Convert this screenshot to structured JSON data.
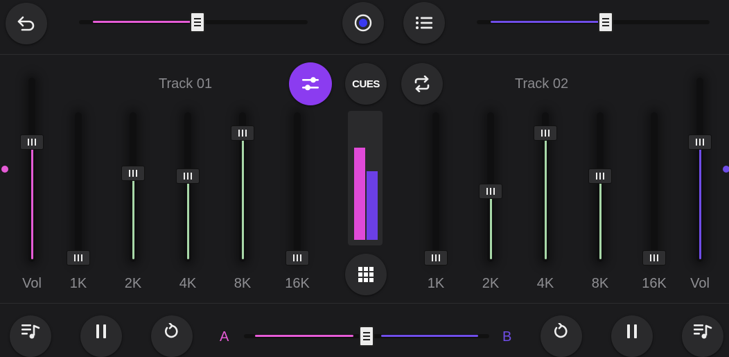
{
  "top": {
    "back_icon": "undo-arrow-icon",
    "record_icon": "record-icon",
    "menu_icon": "list-icon",
    "left_pitch": 0.52,
    "right_pitch": 0.56
  },
  "mixer": {
    "eq_icon": "sliders-icon",
    "cues_label": "CUES",
    "swap_icon": "swap-icon",
    "grid_icon": "grid-icon",
    "track1_title": "Track 01",
    "track2_title": "Track 02",
    "deck1": {
      "vol_label": "Vol",
      "vol_level": 0.82,
      "bands": [
        {
          "label": "1K",
          "level": 0.0
        },
        {
          "label": "2K",
          "level": 0.6
        },
        {
          "label": "4K",
          "level": 0.58
        },
        {
          "label": "8K",
          "level": 0.88
        },
        {
          "label": "16K",
          "level": 0.0
        }
      ]
    },
    "deck2": {
      "vol_label": "Vol",
      "vol_level": 0.82,
      "bands": [
        {
          "label": "1K",
          "level": 0.0
        },
        {
          "label": "2K",
          "level": 0.47
        },
        {
          "label": "4K",
          "level": 0.88
        },
        {
          "label": "8K",
          "level": 0.58
        },
        {
          "label": "16K",
          "level": 0.0
        }
      ]
    },
    "vu_left": 0.83,
    "vu_right": 0.62
  },
  "bottom": {
    "crossfader_a": "A",
    "crossfader_b": "B",
    "crossfader_position": 0.5
  },
  "colors": {
    "deck1": "#e55bd6",
    "deck2": "#6f4de8",
    "eq": "#a8d8a8",
    "accent": "#8b3cf0"
  }
}
